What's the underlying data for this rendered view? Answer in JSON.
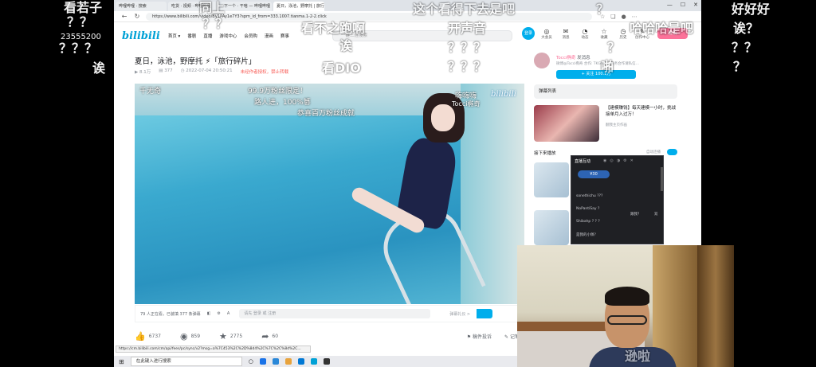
{
  "browser": {
    "tabs": [
      "哔哩哔哩 · 搜索",
      "吃货 · 视频 · 哔哩哔哩",
      "下一个 · 干啥 — 哔哩哔哩",
      "夏日，泳池，野摩托 | 旅行碎片"
    ],
    "url": "https://www.bilibili.com/video/BV1PAy1e7Y3?spm_id_from=333.1007.tianma.1-2-2.click",
    "status_url": "https://cm.bilibili.com/cm/api/fees/pc/sync/v2?msg=a%7C453%2C%2D%8d4%2C%7C%2C%8d%2C..."
  },
  "bilibili": {
    "logo": "bilibili",
    "nav": [
      "首页 ▾",
      "番剧",
      "直播",
      "游戏中心",
      "会员购",
      "漫画",
      "赛事",
      "BLS",
      "下载客户端"
    ],
    "search_placeholder": "一键三连搜索",
    "login": "登录",
    "header_icons": [
      {
        "icon": "vip-icon",
        "label": "大会员"
      },
      {
        "icon": "message-icon",
        "label": "消息"
      },
      {
        "icon": "dynamic-icon",
        "label": "动态"
      },
      {
        "icon": "favorite-icon",
        "label": "收藏"
      },
      {
        "icon": "history-icon",
        "label": "历史"
      },
      {
        "icon": "creator-icon",
        "label": "创作中心"
      }
    ],
    "upload": "投稿"
  },
  "video": {
    "title": "夏日，泳池，野摩托 ⚡「旅行碎片」",
    "views": "8.1万",
    "danmaku_count": "377",
    "date": "2022-07-04 20:50:21",
    "notice": "未经作者授权，禁止转载"
  },
  "player": {
    "overlay_left": "千无奇",
    "overlay_center_1": "99.9万粉丝限定！",
    "overlay_center_2": "路人进，100%篡",
    "overlay_center_3": "恭喜百万粉丝成就",
    "overlay_right_1": "嗨嗨嗨",
    "overlay_right_2": "Tocci椭奇",
    "watermark": "bilibili"
  },
  "below_player": {
    "watching": "79 人正在看，已装填 377 条弹幕",
    "input_placeholder": "请先 登录 或 注册",
    "etiquette": "弹幕礼仪 >"
  },
  "actions": {
    "like": "6737",
    "coin": "859",
    "favorite": "2775",
    "share": "60",
    "report": "稿件投诉",
    "note": "记笔记"
  },
  "up": {
    "name": "Tocci椭奇",
    "badge": "发消息",
    "desc": "微博@Tocci椭奇 合作: TKGNZ... 商务合作请私信...",
    "follow": "+ 关注 100.1万"
  },
  "sidebar": {
    "danmaku_list": "弹幕列表",
    "ad_title": "【建模赚钱】每天建模一小时，挑战接单月入过万！",
    "ad_sub": "翻我主页作画",
    "next_label": "接下来播放",
    "autoplay": "自动连播"
  },
  "chat": {
    "title": "直播互动",
    "badge": "¥30",
    "messages": [
      "sonethichu ???",
      "NoPantiSay ?",
      "Shibahp ? ? ?",
      "是我的小佩？"
    ],
    "labels": [
      "跟我？",
      "双"
    ]
  },
  "taskbar": {
    "search": "在此键入进行搜索"
  },
  "danmaku": [
    {
      "text": "看若子",
      "size": "big"
    },
    {
      "text": "？？",
      "size": "big"
    },
    {
      "text": "23555200",
      "size": "small"
    },
    {
      "text": "？？？",
      "size": "big"
    },
    {
      "text": "诶",
      "size": "big"
    },
    {
      "text": "同上",
      "size": "big"
    },
    {
      "text": "？？",
      "size": "big"
    },
    {
      "text": "看不之跑啊",
      "size": "big"
    },
    {
      "text": "诶",
      "size": "big"
    },
    {
      "text": "看DIO",
      "size": "big"
    },
    {
      "text": "这个看得下去是吧",
      "size": "big"
    },
    {
      "text": "开声音",
      "size": "big"
    },
    {
      "text": "？？？",
      "size": "big"
    },
    {
      "text": "？？？",
      "size": "big"
    },
    {
      "text": "？",
      "size": "big"
    },
    {
      "text": "哈哈哈是吧",
      "size": "big"
    },
    {
      "text": "好好好",
      "size": "big"
    },
    {
      "text": "诶？",
      "size": "big"
    },
    {
      "text": "？？",
      "size": "big"
    },
    {
      "text": "？",
      "size": "big"
    },
    {
      "text": "？",
      "size": "big"
    },
    {
      "text": "啪",
      "size": "big"
    },
    {
      "text": "逊啦",
      "size": "big"
    }
  ]
}
